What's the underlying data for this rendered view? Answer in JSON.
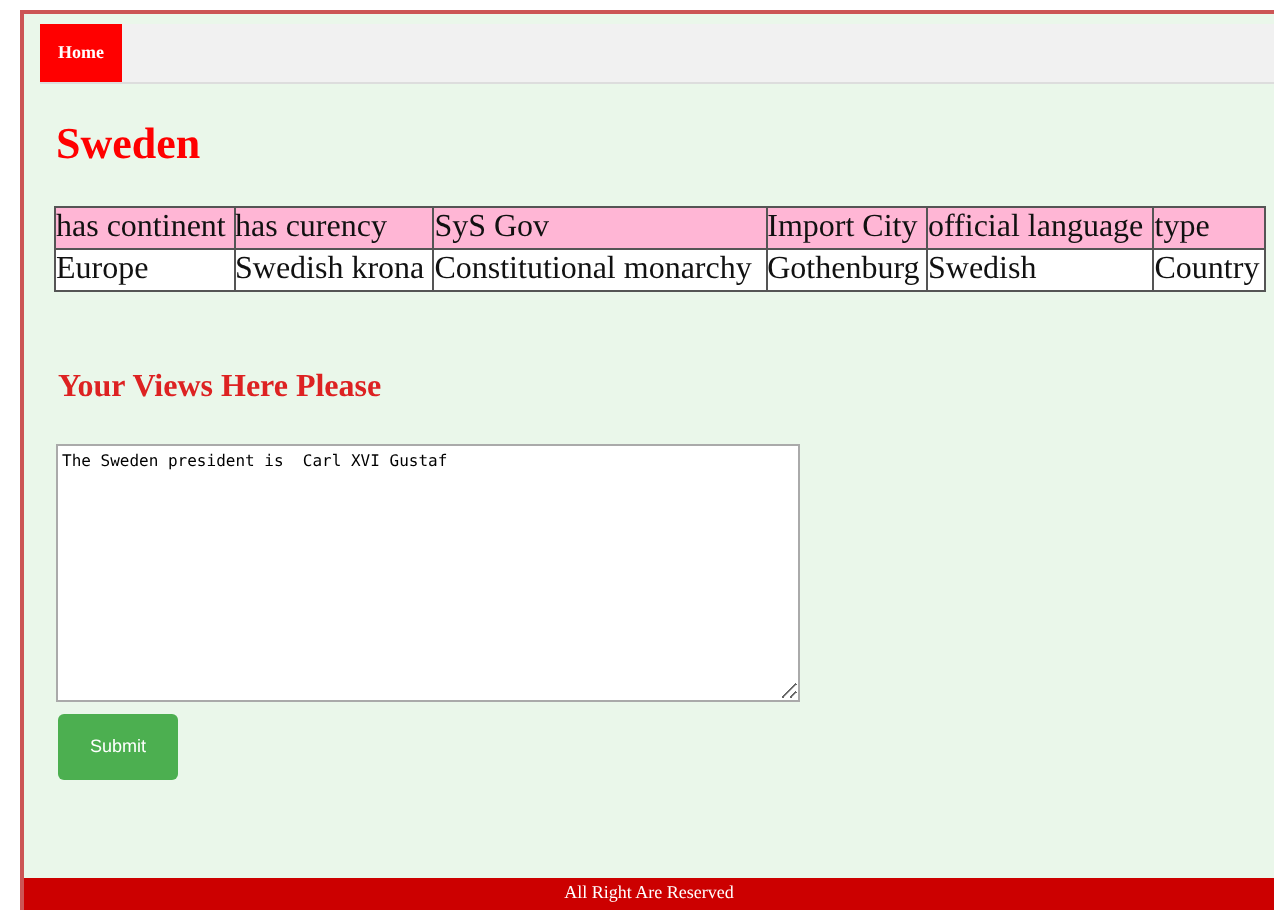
{
  "nav": {
    "items": [
      {
        "label": "Home",
        "selected": true
      }
    ]
  },
  "title": "Sweden",
  "table": {
    "columns": [
      "has continent",
      "has curency",
      "SyS Gov",
      "Import City",
      "official language",
      "type"
    ],
    "rows": [
      [
        "Europe",
        "Swedish krona",
        "Constitutional monarchy",
        "Gothenburg",
        "Swedish",
        "Country"
      ]
    ]
  },
  "views": {
    "heading": "Your Views Here Please",
    "value": "The Sweden president is  Carl XVI Gustaf",
    "button": "Submit"
  },
  "footer": "All Right Are Reserved"
}
